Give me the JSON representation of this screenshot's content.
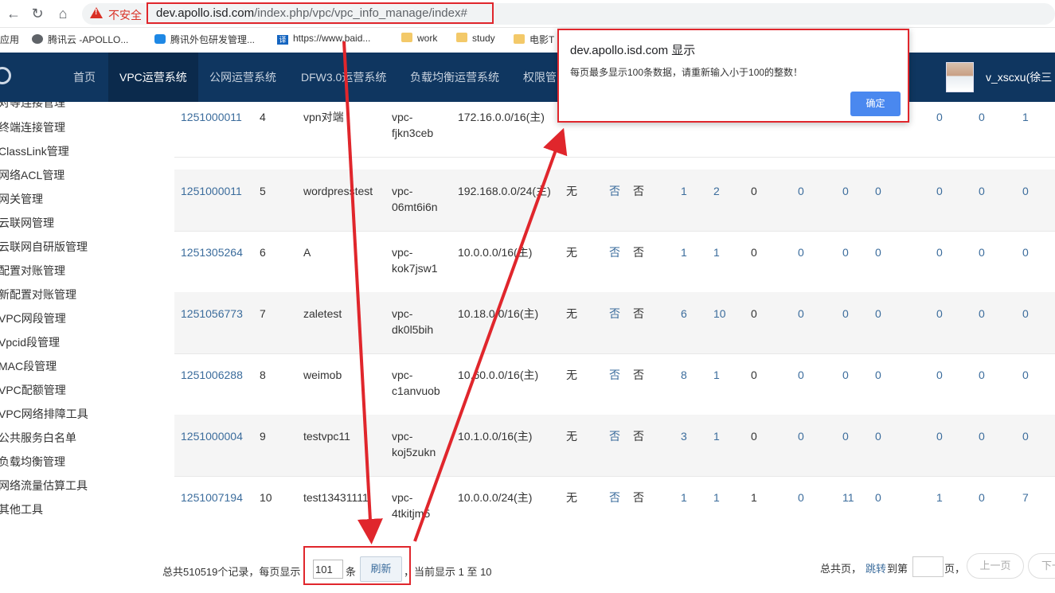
{
  "browser": {
    "back": "←",
    "forward": "→",
    "reload": "↻",
    "home": "⌂",
    "insecure_label": "不安全",
    "url_domain": "dev.apollo.isd.com",
    "url_path": "/index.php/vpc/vpc_info_manage/index#",
    "bookmarks": [
      "应用",
      "腾讯云 -APOLLO...",
      "腾讯外包研发管理...",
      "https://www.baid...",
      "work",
      "study",
      "电影T"
    ]
  },
  "topnav": {
    "items": [
      "首页",
      "VPC运营系统",
      "公网运营系统",
      "DFW3.0运营系统",
      "负载均衡运营系统",
      "权限管"
    ],
    "active_index": 1,
    "username": "v_xscxu(徐三"
  },
  "sidebar": {
    "items": [
      "对等连接管理",
      "终端连接管理",
      "ClassLink管理",
      "网络ACL管理",
      "网关管理",
      "云联网管理",
      "云联网自研版管理",
      "配置对账管理",
      "新配置对账管理",
      "VPC网段管理",
      "Vpcid段管理",
      "MAC段管理",
      "VPC配额管理",
      "VPC网络排障工具",
      "公共服务白名单",
      "负载均衡管理",
      "网络流量估算工具",
      "其他工具"
    ]
  },
  "table": {
    "rows": [
      {
        "appid": "1251000011",
        "no": "4",
        "name": "vpn对端",
        "vpc1": "vpc-",
        "vpc2": "fjkn3ceb",
        "cidr": "172.16.0.0/16(主)",
        "c6": "",
        "c7": "",
        "c8": "",
        "n1": "",
        "n2": "",
        "n3": "",
        "n4": "",
        "n5": "",
        "n6": "",
        "n7": "0",
        "n8": "0",
        "n9": "1"
      },
      {
        "appid": "1251000011",
        "no": "5",
        "name": "wordpresstest",
        "vpc1": "vpc-",
        "vpc2": "06mt6i6n",
        "cidr": "192.168.0.0/24(主)",
        "c6": "无",
        "c7": "否",
        "c8": "否",
        "n1": "1",
        "n2": "2",
        "n3": "0",
        "n4": "0",
        "n5": "0",
        "n6": "0",
        "n7": "0",
        "n8": "0",
        "n9": "0"
      },
      {
        "appid": "1251305264",
        "no": "6",
        "name": "A",
        "vpc1": "vpc-",
        "vpc2": "kok7jsw1",
        "cidr": "10.0.0.0/16(主)",
        "c6": "无",
        "c7": "否",
        "c8": "否",
        "n1": "1",
        "n2": "1",
        "n3": "0",
        "n4": "0",
        "n5": "0",
        "n6": "0",
        "n7": "0",
        "n8": "0",
        "n9": "0"
      },
      {
        "appid": "1251056773",
        "no": "7",
        "name": "zaletest",
        "vpc1": "vpc-",
        "vpc2": "dk0l5bih",
        "cidr": "10.18.0.0/16(主)",
        "c6": "无",
        "c7": "否",
        "c8": "否",
        "n1": "6",
        "n2": "10",
        "n3": "0",
        "n4": "0",
        "n5": "0",
        "n6": "0",
        "n7": "0",
        "n8": "0",
        "n9": "0"
      },
      {
        "appid": "1251006288",
        "no": "8",
        "name": "weimob",
        "vpc1": "vpc-",
        "vpc2": "c1anvuob",
        "cidr": "10.60.0.0/16(主)",
        "c6": "无",
        "c7": "否",
        "c8": "否",
        "n1": "8",
        "n2": "1",
        "n3": "0",
        "n4": "0",
        "n5": "0",
        "n6": "0",
        "n7": "0",
        "n8": "0",
        "n9": "0"
      },
      {
        "appid": "1251000004",
        "no": "9",
        "name": "testvpc11",
        "vpc1": "vpc-",
        "vpc2": "koj5zukn",
        "cidr": "10.1.0.0/16(主)",
        "c6": "无",
        "c7": "否",
        "c8": "否",
        "n1": "3",
        "n2": "1",
        "n3": "0",
        "n4": "0",
        "n5": "0",
        "n6": "0",
        "n7": "0",
        "n8": "0",
        "n9": "0"
      },
      {
        "appid": "1251007194",
        "no": "10",
        "name": "test13431111",
        "vpc1": "vpc-",
        "vpc2": "4tkitjm5",
        "cidr": "10.0.0.0/24(主)",
        "c6": "无",
        "c7": "否",
        "c8": "否",
        "n1": "1",
        "n2": "1",
        "n3": "1",
        "n4": "0",
        "n5": "11",
        "n6": "0",
        "n7": "1",
        "n8": "0",
        "n9": "7"
      }
    ]
  },
  "pager": {
    "total_prefix": "总共510519个记录，每页显示",
    "page_size": "101",
    "unit": "条",
    "refresh": "刷新",
    "current": "，当前显示 1 至 10",
    "total_pages": "总共页，",
    "jump": "跳转",
    "to_page": "到第",
    "page_suffix": "页，",
    "prev": "上一页",
    "next": "下一"
  },
  "dialog": {
    "title": "dev.apollo.isd.com 显示",
    "message": "每页最多显示100条数据，请重新输入小于100的整数！",
    "ok": "确定"
  },
  "colors": {
    "nav_bg": "#0f3660",
    "nav_active": "#0b2a4c",
    "link": "#3b6c9c",
    "annotation_red": "#e0262c",
    "ok_button": "#4a88ef"
  }
}
